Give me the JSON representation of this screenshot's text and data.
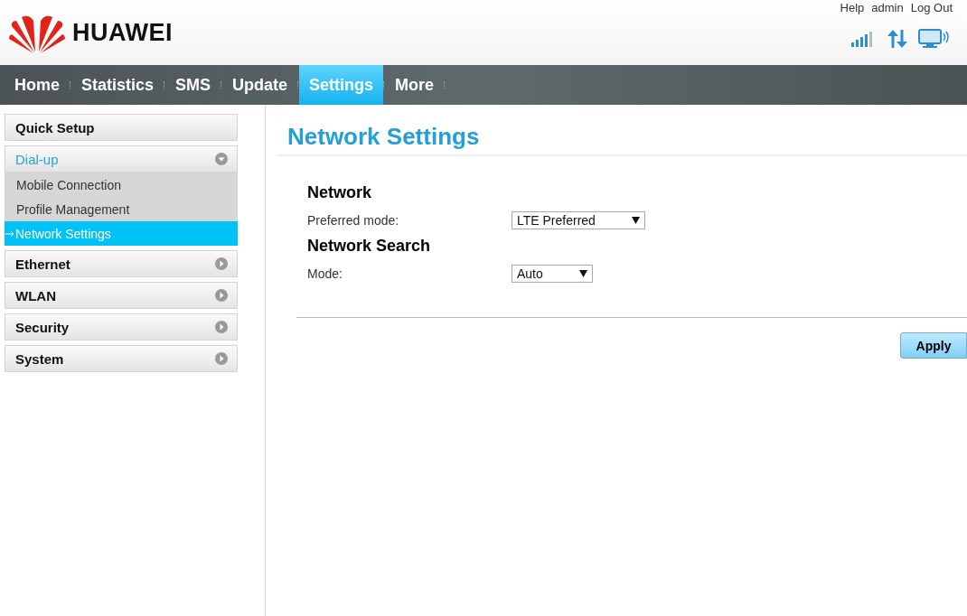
{
  "header": {
    "brand": "HUAWEI",
    "links": [
      "Help",
      "admin",
      "Log Out"
    ]
  },
  "nav": [
    {
      "label": "Home",
      "selected": false
    },
    {
      "label": "Statistics",
      "selected": false
    },
    {
      "label": "SMS",
      "selected": false
    },
    {
      "label": "Update",
      "selected": false
    },
    {
      "label": "Settings",
      "selected": true
    },
    {
      "label": "More",
      "selected": false
    }
  ],
  "sidebar": {
    "items": [
      {
        "kind": "link",
        "label": "Quick Setup"
      },
      {
        "kind": "group",
        "label": "Dial-up",
        "expanded": true,
        "children": [
          {
            "label": "Mobile Connection",
            "selected": false
          },
          {
            "label": "Profile Management",
            "selected": false
          },
          {
            "label": "Network Settings",
            "selected": true
          }
        ]
      },
      {
        "kind": "group",
        "label": "Ethernet",
        "expanded": false
      },
      {
        "kind": "group",
        "label": "WLAN",
        "expanded": false
      },
      {
        "kind": "group",
        "label": "Security",
        "expanded": false
      },
      {
        "kind": "group",
        "label": "System",
        "expanded": false
      }
    ]
  },
  "content": {
    "title": "Network Settings",
    "sections": [
      {
        "heading": "Network",
        "fields": [
          {
            "label": "Preferred mode:",
            "value": "LTE Preferred"
          }
        ]
      },
      {
        "heading": "Network Search",
        "fields": [
          {
            "label": "Mode:",
            "value": "Auto"
          }
        ]
      }
    ],
    "button": "Apply"
  }
}
